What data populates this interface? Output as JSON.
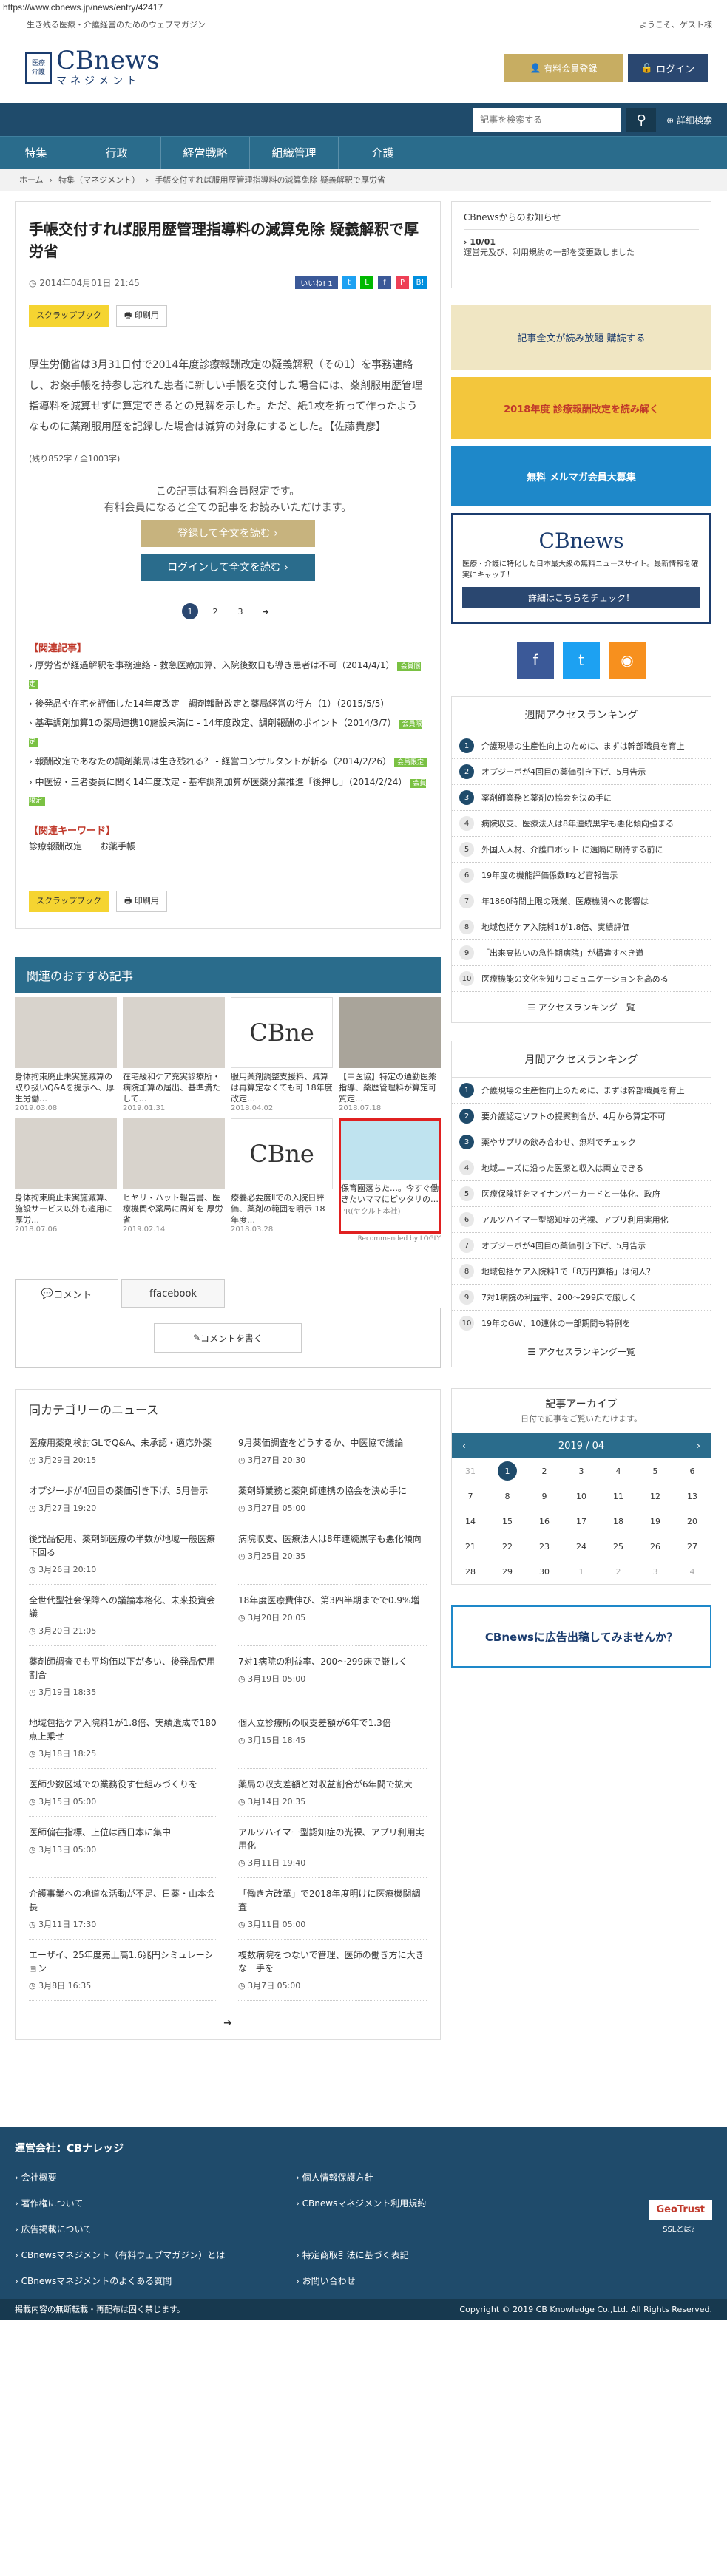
{
  "url": "https://www.cbnews.jp/news/entry/42417",
  "topbar": {
    "tagline": "生き残る医療・介護経営のためのウェブマガジン",
    "welcome": "ようこそ、ゲスト様"
  },
  "logo": {
    "badge1": "医療",
    "badge2": "介護",
    "name": "CBnews",
    "sub": "マネジメント"
  },
  "header": {
    "register": "有料会員登録",
    "login": "ログイン"
  },
  "search": {
    "placeholder": "記事を検索する",
    "advanced": "詳細検索"
  },
  "nav": [
    "特集",
    "行政",
    "経営戦略",
    "組織管理",
    "介護"
  ],
  "breadcrumb": [
    "ホーム",
    "特集（マネジメント）",
    "手帳交付すれば服用歴管理指導料の減算免除 疑義解釈で厚労省"
  ],
  "article": {
    "title": "手帳交付すれば服用歴管理指導料の減算免除 疑義解釈で厚労省",
    "date": "2014年04月01日 21:45",
    "likes": "いいね! 1",
    "scrap": "スクラップブック",
    "print": "印刷用",
    "lead": "厚生労働省は3月31日付で2014年度診療報酬改定の疑義解釈（その1）を事務連絡し、お薬手帳を持参し忘れた患者に新しい手帳を交付した場合には、薬剤服用歴管理指導料を減算せずに算定できるとの見解を示した。ただ、紙1枚を折って作ったようなものに薬剤服用歴を記録した場合は減算の対象にするとした。【佐藤貴彦】",
    "remain": "(残り852字 / 全1003字)",
    "pay1": "この記事は有料会員限定です。",
    "pay2": "有料会員になると全ての記事をお読みいただけます。",
    "reg_btn": "登録して全文を読む",
    "login_btn": "ログインして全文を読む",
    "pages": [
      "1",
      "2",
      "3"
    ]
  },
  "related": {
    "title": "【関連記事】",
    "items": [
      {
        "t": "厚労省が経過解釈を事務連絡 - 救急医療加算、入院後数日も導き患者は不可（2014/4/1）",
        "new": "会員限定"
      },
      {
        "t": "後発品や在宅を評価した14年度改定 - 調剤報酬改定と薬局経営の行方（1）（2015/5/5）",
        "new": ""
      },
      {
        "t": "基準調剤加算1の薬局連携10施設未満に - 14年度改定、調剤報酬のポイント（2014/3/7）",
        "new": "会員限定"
      },
      {
        "t": "報酬改定であなたの調剤薬局は生き残れる？ - 経営コンサルタントが斬る（2014/2/26）",
        "new": "会員限定"
      },
      {
        "t": "中医協・三者委員に聞く14年度改定 - 基準調剤加算が医薬分業推進「後押し」（2014/2/24）",
        "new": "会員限定"
      }
    ],
    "kw_title": "【関連キーワード】",
    "kws": [
      "診療報酬改定",
      "お薬手帳"
    ]
  },
  "rec": {
    "title": "関連のおすすめ記事",
    "items": [
      {
        "t": "身体拘束廃止未実施減算の取り扱いQ&Aを提示へ、厚生労働…",
        "d": "2019.03.08"
      },
      {
        "t": "在宅緩和ケア充実診療所・病院加算の届出、基準満たして…",
        "d": "2019.01.31"
      },
      {
        "t": "服用薬剤調整支援料、減算は再算定なくても可 18年度改定…",
        "d": "2018.04.02"
      },
      {
        "t": "【中医協】特定の通勤医薬指導、薬歴管理料が算定可 質定…",
        "d": "2018.07.18"
      },
      {
        "t": "身体拘束廃止未実施減算、施設サービス以外も適用に 厚労…",
        "d": "2018.07.06"
      },
      {
        "t": "ヒヤリ・ハット報告書、医療機関や薬局に周知を 厚労省",
        "d": "2019.02.14"
      },
      {
        "t": "療養必要度Ⅱでの入院日評価、薬剤の範囲を明示 18年度…",
        "d": "2018.03.28"
      },
      {
        "t": "保育園落ちた…。今すぐ働きたいママにピッタリの…",
        "d": "PR(ヤクルト本社)"
      }
    ],
    "powered": "Recommended by LOGLY"
  },
  "comments": {
    "tab1": "コメント",
    "tab2": "facebook",
    "write": "コメントを書く"
  },
  "samecat": {
    "title": "同カテゴリーのニュース",
    "items": [
      {
        "t": "医療用薬剤検討GLでQ&A、未承認・適応外薬",
        "d": "3月29日 20:15"
      },
      {
        "t": "9月薬価調査をどうするか、中医協で議論",
        "d": "3月27日 20:30"
      },
      {
        "t": "オプジーボが4回目の薬価引き下げ、5月告示",
        "d": "3月27日 19:20"
      },
      {
        "t": "薬剤師業務と薬剤師連携の協会を決め手に",
        "d": "3月27日 05:00"
      },
      {
        "t": "後発品使用、薬剤師医療の半数が地域一般医療下回る",
        "d": "3月26日 20:10"
      },
      {
        "t": "病院収支、医療法人は8年連続黒字も悪化傾向",
        "d": "3月25日 20:35"
      },
      {
        "t": "全世代型社会保障への議論本格化、未来投資会議",
        "d": "3月20日 21:05"
      },
      {
        "t": "18年度医療費伸び、第3四半期までで0.9%増",
        "d": "3月20日 20:05"
      },
      {
        "t": "薬剤師調査でも平均価以下が多い、後発品使用割合",
        "d": "3月19日 18:35"
      },
      {
        "t": "7対1病院の利益率、200～299床で厳しく",
        "d": "3月19日 05:00"
      },
      {
        "t": "地域包括ケア入院料1が1.8倍、実績遺成で180点上乗せ",
        "d": "3月18日 18:25"
      },
      {
        "t": "個人立診療所の収支差額が6年で1.3倍",
        "d": "3月15日 18:45"
      },
      {
        "t": "医師少数区域での業務役す仕組みづくりを",
        "d": "3月15日 05:00"
      },
      {
        "t": "薬局の収支差額と対収益割合が6年間で拡大",
        "d": "3月14日 20:35"
      },
      {
        "t": "医師偏在指標、上位は西日本に集中",
        "d": "3月13日 05:00"
      },
      {
        "t": "アルツハイマー型認知症の光裸、アプリ利用実用化",
        "d": "3月11日 19:40"
      },
      {
        "t": "介護事業への地道な活動が不足、日薬・山本会長",
        "d": "3月11日 17:30"
      },
      {
        "t": "「働き方改革」で2018年度明けに医療機関調査",
        "d": "3月11日 05:00"
      },
      {
        "t": "エーザイ、25年度売上高1.6兆円シミュレーション",
        "d": "3月8日 16:35"
      },
      {
        "t": "複数病院をつないで管理、医師の働き方に大きな一手を",
        "d": "3月7日 05:00"
      }
    ]
  },
  "sidebar": {
    "news_title": "CBnewsからのお知らせ",
    "news_date": "10/01",
    "news_text": "運営元及び、利用規約の一部を変更致しました",
    "bn1": "記事全文が読み放題 購読する",
    "bn2": "2018年度 診療報酬改定を読み解く",
    "bn3": "無料 メルマガ会員大募集",
    "bn4": "医療・介護に特化した日本最大級の無料ニュースサイト。最新情報を確実にキャッチ！",
    "bn4_btn": "詳細はこちらをチェック！",
    "bn5": "CBnewsに広告出稿してみませんか？"
  },
  "weekly": {
    "title": "週間アクセスランキング",
    "items": [
      "介護現場の生産性向上のために、まずは幹部職員を育上",
      "オプジーボが4回目の薬価引き下げ、5月告示",
      "薬剤師業務と薬剤の協会を決め手に",
      "病院収支、医療法人は8年連続黒字も悪化傾向強まる",
      "外国人人材、介護ロボット に遠隔に期待する前に",
      "19年度の機能評価係数Ⅱなど官報告示",
      "年1860時間上限の残業、医療機関への影響は",
      "地域包括ケア入院料1が1.8倍、実績評価",
      "「出来高払いの急性期病院」が構造すべき道",
      "医療機能の文化を知りコミュニケーションを高める"
    ],
    "more": "アクセスランキング一覧"
  },
  "monthly": {
    "title": "月間アクセスランキング",
    "items": [
      "介護現場の生産性向上のために、まずは幹部職員を育上",
      "要介護認定ソフトの提案割合が、4月から算定不可",
      "薬やサプリの飲み合わせ、無料でチェック",
      "地域ニーズに沿った医療と収入は両立できる",
      "医療保険証をマイナンバーカードと一体化、政府",
      "アルツハイマー型認知症の光裸、アプリ利用実用化",
      "オプジーボが4回目の薬価引き下げ、5月告示",
      "地域包括ケア入院料1で「8万円算格」は何人？",
      "7対1病院の利益率、200～299床で厳しく",
      "19年のGW、10連休の一部期間も特例を"
    ],
    "more": "アクセスランキング一覧"
  },
  "archive": {
    "title": "記事アーカイブ",
    "sub": "日付で記事をご覧いただけます。",
    "month": "2019 / 04",
    "days": [
      "31",
      "1",
      "2",
      "3",
      "4",
      "5",
      "6",
      "7",
      "8",
      "9",
      "10",
      "11",
      "12",
      "13",
      "14",
      "15",
      "16",
      "17",
      "18",
      "19",
      "20",
      "21",
      "22",
      "23",
      "24",
      "25",
      "26",
      "27",
      "28",
      "29",
      "30",
      "1",
      "2",
      "3",
      "4"
    ]
  },
  "footer": {
    "company": "運営会社：CBナレッジ",
    "links": [
      "会社概要",
      "個人情報保護方針",
      "著作権について",
      "CBnewsマネジメント利用規約",
      "広告掲載について",
      "",
      "CBnewsマネジメント（有料ウェブマガジン）とは",
      "特定商取引法に基づく表記",
      "CBnewsマネジメントのよくある質問",
      "お問い合わせ"
    ],
    "ssl": "SSLとは？",
    "geotrust": "GeoTrust",
    "notice": "掲載内容の無断転載・再配布は固く禁じます。",
    "copyright": "Copyright © 2019 CB Knowledge Co.,Ltd. All Rights Reserved."
  },
  "colors": {
    "navy": "#1f4b6b",
    "teal": "#2a6c8c",
    "gold": "#c7ad62"
  }
}
